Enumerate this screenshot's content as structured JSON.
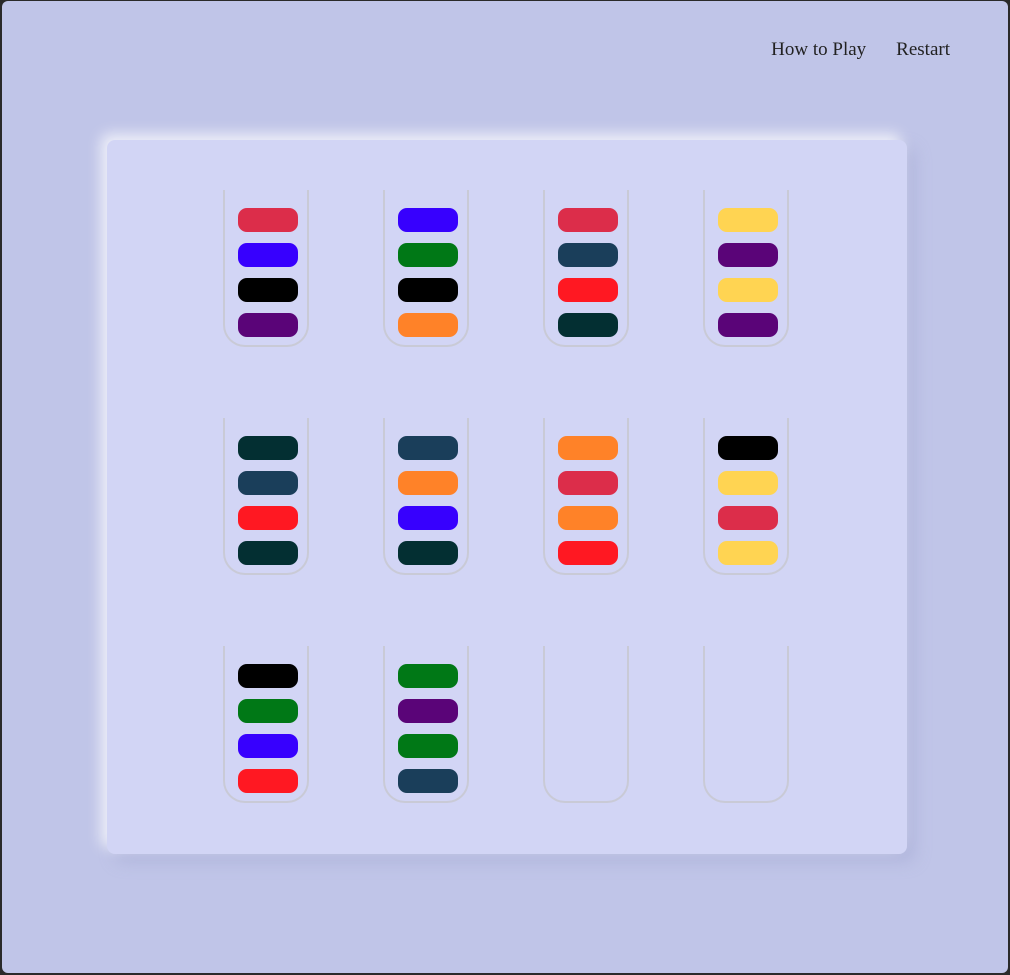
{
  "nav": {
    "how_to_play": "How to Play",
    "restart": "Restart"
  },
  "colors": {
    "crimson": "#dc2d4a",
    "blue": "#3700fe",
    "black": "#000000",
    "purple": "#5a0478",
    "green": "#007816",
    "orange": "#ff8228",
    "navy": "#1a3e5a",
    "red": "#ff1822",
    "dark-teal": "#032f32",
    "yellow": "#ffd452"
  },
  "tubes": [
    [
      "crimson",
      "blue",
      "black",
      "purple"
    ],
    [
      "blue",
      "green",
      "black",
      "orange"
    ],
    [
      "crimson",
      "navy",
      "red",
      "dark-teal"
    ],
    [
      "yellow",
      "purple",
      "yellow",
      "purple"
    ],
    [
      "dark-teal",
      "navy",
      "red",
      "dark-teal"
    ],
    [
      "navy",
      "orange",
      "blue",
      "dark-teal"
    ],
    [
      "orange",
      "crimson",
      "orange",
      "red"
    ],
    [
      "black",
      "yellow",
      "crimson",
      "yellow"
    ],
    [
      "black",
      "green",
      "blue",
      "red"
    ],
    [
      "green",
      "purple",
      "green",
      "navy"
    ],
    [],
    []
  ]
}
